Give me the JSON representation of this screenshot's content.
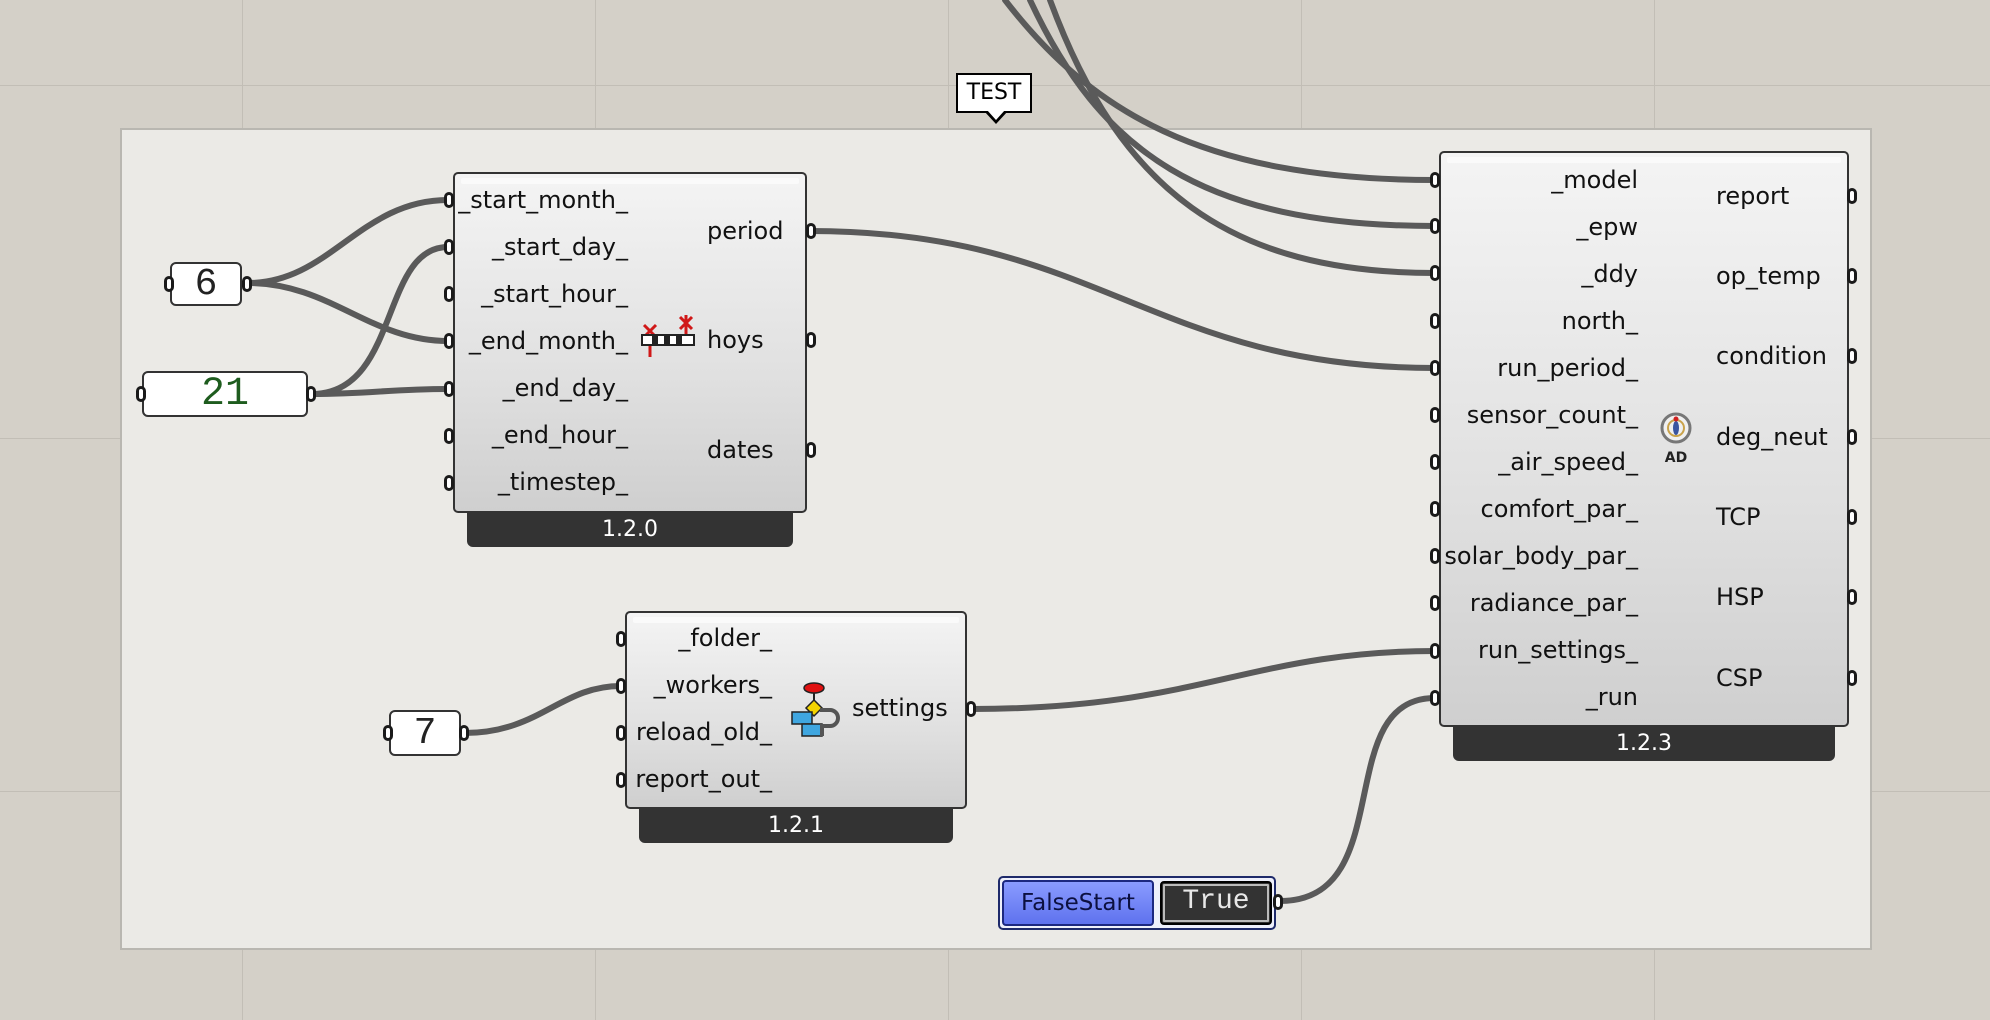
{
  "group": {
    "label": "TEST"
  },
  "analysis_period": {
    "inputs": [
      "_start_month_",
      "_start_day_",
      "_start_hour_",
      "_end_month_",
      "_end_day_",
      "_end_hour_",
      "_timestep_"
    ],
    "outputs": [
      "period",
      "hoys",
      "dates"
    ],
    "version": "1.2.0",
    "icon": "analysis-period-icon"
  },
  "run_settings": {
    "inputs": [
      "_folder_",
      "_workers_",
      "reload_old_",
      "report_out_"
    ],
    "outputs": [
      "settings"
    ],
    "version": "1.2.1",
    "icon": "run-settings-icon"
  },
  "comfort_map": {
    "inputs": [
      "_model",
      "_epw",
      "_ddy",
      "north_",
      "run_period_",
      "sensor_count_",
      "_air_speed_",
      "comfort_par_",
      "solar_body_par_",
      "radiance_par_",
      "run_settings_",
      "_run"
    ],
    "outputs": [
      "report",
      "op_temp",
      "condition",
      "deg_neut",
      "TCP",
      "HSP",
      "CSP"
    ],
    "version": "1.2.3",
    "icon": "adaptive-comfort-map-icon"
  },
  "panels": {
    "month": "6",
    "day": "21",
    "workers": "7"
  },
  "toggle": {
    "label": "FalseStart",
    "value": "True"
  },
  "colors": {
    "canvas": "#d4d0c8",
    "group": "#ebeae6",
    "wire": "#5a5a5a",
    "toggle_accent": "#6a7cf4"
  }
}
